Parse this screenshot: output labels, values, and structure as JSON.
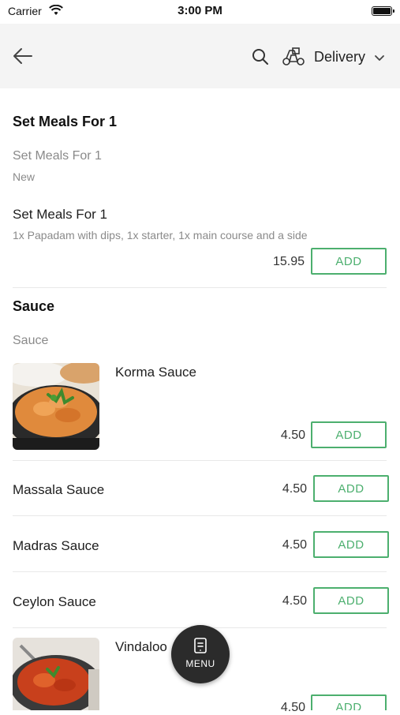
{
  "status_bar": {
    "carrier": "Carrier",
    "time": "3:00 PM"
  },
  "header": {
    "delivery_label": "Delivery"
  },
  "categories": [
    {
      "title": "Set Meals For 1",
      "subtitle": "Set Meals For 1",
      "subtitle_desc": "New",
      "items": [
        {
          "name": "Set Meals For 1",
          "description": "1x Papadam with dips, 1x starter, 1x main course and a side",
          "price": "15.95",
          "button": "ADD"
        }
      ]
    },
    {
      "title": "Sauce",
      "subtitle": "Sauce",
      "items": [
        {
          "name": "Korma Sauce",
          "price": "4.50",
          "button": "ADD",
          "image": "curry-bowl"
        },
        {
          "name": "Massala Sauce",
          "price": "4.50",
          "button": "ADD"
        },
        {
          "name": "Madras Sauce",
          "price": "4.50",
          "button": "ADD"
        },
        {
          "name": "Ceylon Sauce",
          "price": "4.50",
          "button": "ADD"
        },
        {
          "name": "Vindaloo",
          "price": "4.50",
          "button": "ADD",
          "image": "curry-dish"
        }
      ]
    }
  ],
  "fab": {
    "label": "MENU"
  },
  "colors": {
    "accent": "#4caf6e",
    "header_bg": "#f4f4f4",
    "fab_bg": "#2b2b2b"
  }
}
